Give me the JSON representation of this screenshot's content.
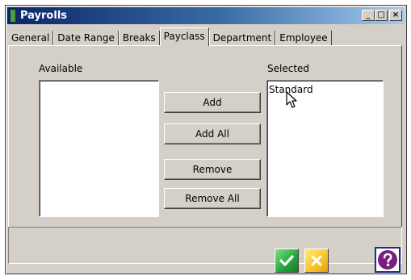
{
  "window": {
    "title": "Payrolls",
    "minimize_label": "_",
    "maximize_label": "□",
    "close_label": "×"
  },
  "tabs": [
    {
      "label": "General"
    },
    {
      "label": "Date Range"
    },
    {
      "label": "Breaks"
    },
    {
      "label": "Payclass",
      "active": true
    },
    {
      "label": "Department"
    },
    {
      "label": "Employee"
    }
  ],
  "available": {
    "label": "Available",
    "items": []
  },
  "selected": {
    "label": "Selected",
    "items": [
      "Standard"
    ]
  },
  "buttons": {
    "add": "Add",
    "add_all": "Add All",
    "remove": "Remove",
    "remove_all": "Remove All"
  },
  "footer": {
    "ok_icon": "check-icon",
    "cancel_icon": "x-icon",
    "help_icon": "question-icon"
  }
}
